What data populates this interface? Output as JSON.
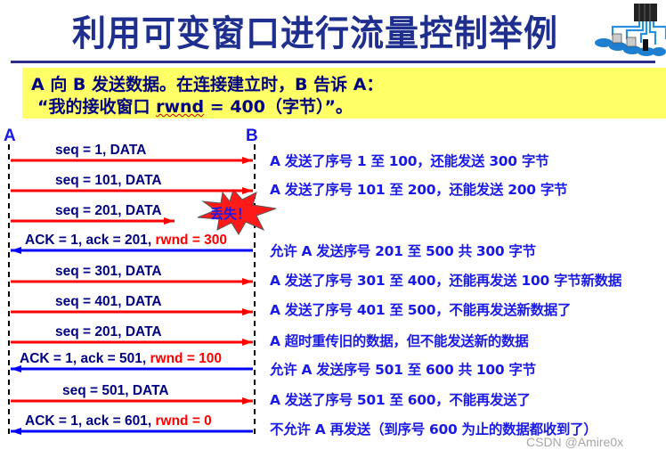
{
  "title": "利用可变窗口进行流量控制举例",
  "logo_icon": "network-servers-icon",
  "intro": {
    "line1": "A 向 B 发送数据。在连接建立时，B 告诉 A：",
    "line2_prefix": "“我的接收窗口 ",
    "line2_rwnd": "rwnd",
    "line2_suffix": " = 400（字节）”。"
  },
  "endpoints": {
    "left": "A",
    "right": "B"
  },
  "colors": {
    "data_arrow": "#ff0000",
    "ack_arrow": "#0000ff",
    "label": "#000080",
    "note": "#1a1ae6",
    "highlight": "#ffff66"
  },
  "messages": [
    {
      "direction": "A->B",
      "label": "seq = 1, DATA",
      "rwnd": "",
      "lost": false,
      "note": "A 发送了序号 1 至 100，还能发送 300 字节"
    },
    {
      "direction": "A->B",
      "label": "seq = 101, DATA",
      "rwnd": "",
      "lost": false,
      "note": "A 发送了序号 101 至 200，还能发送 200 字节"
    },
    {
      "direction": "A->B",
      "label": "seq = 201, DATA",
      "rwnd": "",
      "lost": true,
      "note": ""
    },
    {
      "direction": "B->A",
      "label": "ACK = 1, ack = 201, ",
      "rwnd": "rwnd = 300",
      "lost": false,
      "note": "允许 A 发送序号 201 至 500  共 300 字节"
    },
    {
      "direction": "A->B",
      "label": "seq = 301, DATA",
      "rwnd": "",
      "lost": false,
      "note": "A 发送了序号 301 至 400，还能再发送 100 字节新数据"
    },
    {
      "direction": "A->B",
      "label": "seq = 401, DATA",
      "rwnd": "",
      "lost": false,
      "note": "A 发送了序号 401 至 500，不能再发送新数据了"
    },
    {
      "direction": "A->B",
      "label": "seq = 201, DATA",
      "rwnd": "",
      "lost": false,
      "note": "A 超时重传旧的数据，但不能发送新的数据"
    },
    {
      "direction": "B->A",
      "label": "ACK = 1, ack = 501, ",
      "rwnd": "rwnd = 100",
      "lost": false,
      "note": "允许 A 发送序号 501 至 600 共 100 字节"
    },
    {
      "direction": "A->B",
      "label": "seq = 501, DATA",
      "rwnd": "",
      "lost": false,
      "note": "A 发送了序号 501 至 600，不能再发送了"
    },
    {
      "direction": "B->A",
      "label": "ACK = 1, ack = 601, ",
      "rwnd": "rwnd = 0",
      "lost": false,
      "note": "不允许 A 再发送（到序号 600 为止的数据都收到了）"
    }
  ],
  "lost_label": "丢失！",
  "watermark": "CSDN @Amire0x"
}
